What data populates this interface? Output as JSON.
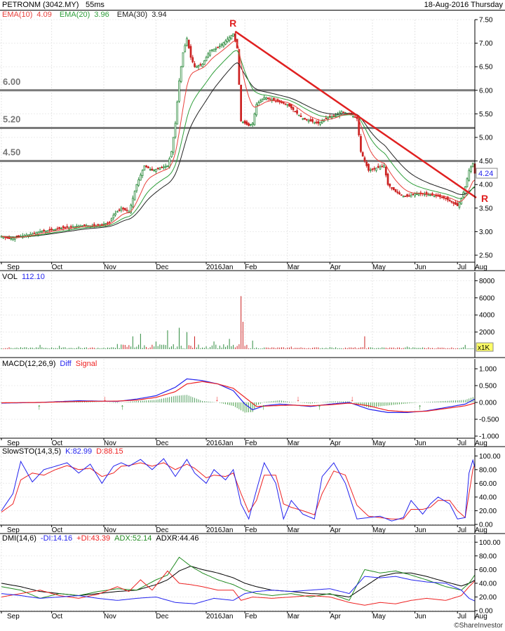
{
  "header": {
    "symbol": "PETRONM (3042.MY)",
    "timeframe": "55ms",
    "date": "18-Aug-2016 Thursday"
  },
  "brand": "©ShareInvestor",
  "colors": {
    "ema10": "#e8413c",
    "ema20": "#2e9e3a",
    "ema30": "#222222",
    "up": "#2e8b3e",
    "down": "#cc2222",
    "trend": "#e02020",
    "hline": "#7a7a7a",
    "blue": "#2222ee",
    "red": "#ee2222",
    "green": "#228b22",
    "black": "#000000"
  },
  "x_labels": [
    "Sep",
    "Oct",
    "Nov",
    "Dec",
    "2016Jan",
    "Feb",
    "Mar",
    "Apr",
    "May",
    "Jun",
    "Jul",
    "Aug"
  ],
  "panels": {
    "price": {
      "legend": [
        {
          "name": "EMA(10)",
          "value": "4.09",
          "color": "#e8413c"
        },
        {
          "name": "EMA(20)",
          "value": "3.96",
          "color": "#2e9e3a"
        },
        {
          "name": "EMA(30)",
          "value": "3.94",
          "color": "#222222"
        }
      ],
      "y_ticks": [
        "2.50",
        "3.00",
        "3.50",
        "4.00",
        "4.50",
        "5.00",
        "5.50",
        "6.00",
        "6.50",
        "7.00",
        "7.50"
      ],
      "h_levels": [
        {
          "value": 6.0,
          "label": "6.00"
        },
        {
          "value": 5.2,
          "label": "5.20"
        },
        {
          "value": 4.5,
          "label": "4.50"
        }
      ],
      "last_price": "4.24",
      "peak_marks": [
        "R",
        "R"
      ]
    },
    "vol": {
      "legend": [
        {
          "name": "VOL",
          "value": "112.10"
        }
      ],
      "y_ticks": [
        "2000",
        "4000",
        "6000",
        "8000"
      ],
      "unit": "x1K"
    },
    "macd": {
      "legend": [
        {
          "name": "MACD(12,26,9)"
        },
        {
          "name": "Diff"
        },
        {
          "name": "Signal"
        }
      ],
      "y_ticks": [
        "1.000",
        "0.500",
        "0.000",
        "-0.500",
        "-1.000"
      ]
    },
    "sto": {
      "legend": [
        {
          "name": "SlowSTO(14,3,5)"
        },
        {
          "name": "K:82.99"
        },
        {
          "name": "D:88.15"
        }
      ],
      "y_ticks": [
        "0.00",
        "20.00",
        "40.00",
        "60.00",
        "80.00",
        "100.00"
      ]
    },
    "dmi": {
      "legend": [
        {
          "name": "DMI(14,6)"
        },
        {
          "name": "-DI:14.16"
        },
        {
          "name": "+DI:43.39"
        },
        {
          "name": "ADX:52.14"
        },
        {
          "name": "ADXR:44.46"
        }
      ],
      "y_ticks": [
        "0.00",
        "20.00",
        "40.00",
        "60.00",
        "80.00",
        "100.00"
      ]
    }
  },
  "chart_data": {
    "type": "line",
    "title": "PETRONM (3042.MY)",
    "x": [
      "Sep",
      "Oct",
      "Nov",
      "Dec",
      "2016Jan",
      "Feb",
      "Mar",
      "Apr",
      "May",
      "Jun",
      "Jul",
      "Aug"
    ],
    "price_keypoints": [
      [
        0,
        2.9
      ],
      [
        4,
        2.85
      ],
      [
        8,
        2.88
      ],
      [
        12,
        2.92
      ],
      [
        16,
        2.95
      ],
      [
        20,
        3.0
      ],
      [
        24,
        3.02
      ],
      [
        28,
        3.05
      ],
      [
        32,
        3.08
      ],
      [
        36,
        3.1
      ],
      [
        40,
        3.12
      ],
      [
        44,
        3.13
      ],
      [
        48,
        3.12
      ],
      [
        52,
        3.15
      ],
      [
        56,
        3.2
      ],
      [
        58,
        3.35
      ],
      [
        62,
        3.5
      ],
      [
        66,
        3.42
      ],
      [
        70,
        4.0
      ],
      [
        74,
        4.4
      ],
      [
        78,
        4.3
      ],
      [
        82,
        4.35
      ],
      [
        86,
        4.4
      ],
      [
        88,
        4.7
      ],
      [
        90,
        5.3
      ],
      [
        92,
        6.2
      ],
      [
        94,
        6.8
      ],
      [
        96,
        7.1
      ],
      [
        98,
        6.7
      ],
      [
        100,
        6.5
      ],
      [
        104,
        6.55
      ],
      [
        108,
        6.85
      ],
      [
        112,
        6.9
      ],
      [
        116,
        7.05
      ],
      [
        120,
        7.2
      ],
      [
        122,
        6.9
      ],
      [
        124,
        5.35
      ],
      [
        126,
        5.3
      ],
      [
        128,
        5.25
      ],
      [
        130,
        5.3
      ],
      [
        132,
        5.7
      ],
      [
        136,
        5.85
      ],
      [
        140,
        5.8
      ],
      [
        144,
        5.75
      ],
      [
        148,
        5.7
      ],
      [
        152,
        5.55
      ],
      [
        156,
        5.4
      ],
      [
        160,
        5.35
      ],
      [
        164,
        5.3
      ],
      [
        168,
        5.4
      ],
      [
        172,
        5.45
      ],
      [
        176,
        5.55
      ],
      [
        180,
        5.5
      ],
      [
        184,
        5.4
      ],
      [
        186,
        4.7
      ],
      [
        190,
        4.3
      ],
      [
        194,
        4.35
      ],
      [
        198,
        4.4
      ],
      [
        200,
        4.0
      ],
      [
        204,
        3.85
      ],
      [
        208,
        3.75
      ],
      [
        210,
        3.75
      ],
      [
        214,
        3.8
      ],
      [
        218,
        3.8
      ],
      [
        222,
        3.78
      ],
      [
        226,
        3.75
      ],
      [
        230,
        3.7
      ],
      [
        234,
        3.6
      ],
      [
        236,
        3.55
      ],
      [
        238,
        3.7
      ],
      [
        240,
        3.95
      ],
      [
        242,
        4.3
      ],
      [
        244,
        4.45
      ],
      [
        245,
        4.24
      ]
    ],
    "ema10_last": 4.09,
    "ema20_last": 3.96,
    "ema30_last": 3.94,
    "volume_spikes": [
      [
        20,
        500
      ],
      [
        30,
        400
      ],
      [
        40,
        300
      ],
      [
        60,
        600
      ],
      [
        68,
        1500
      ],
      [
        72,
        1800
      ],
      [
        80,
        900
      ],
      [
        86,
        2200
      ],
      [
        92,
        2500
      ],
      [
        96,
        2000
      ],
      [
        100,
        1500
      ],
      [
        110,
        900
      ],
      [
        118,
        1200
      ],
      [
        124,
        6200
      ],
      [
        125,
        3200
      ],
      [
        130,
        1000
      ],
      [
        150,
        300
      ],
      [
        170,
        250
      ],
      [
        188,
        1500
      ],
      [
        210,
        300
      ],
      [
        240,
        500
      ],
      [
        245,
        112.1
      ]
    ],
    "macd_diff_keypoints": [
      [
        0,
        -0.02
      ],
      [
        20,
        0.0
      ],
      [
        40,
        0.05
      ],
      [
        60,
        0.03
      ],
      [
        70,
        0.1
      ],
      [
        80,
        0.2
      ],
      [
        90,
        0.45
      ],
      [
        96,
        0.7
      ],
      [
        104,
        0.65
      ],
      [
        112,
        0.55
      ],
      [
        120,
        0.35
      ],
      [
        126,
        -0.05
      ],
      [
        130,
        -0.22
      ],
      [
        136,
        -0.1
      ],
      [
        144,
        -0.05
      ],
      [
        152,
        -0.08
      ],
      [
        160,
        -0.12
      ],
      [
        170,
        -0.05
      ],
      [
        180,
        0.0
      ],
      [
        190,
        -0.2
      ],
      [
        200,
        -0.3
      ],
      [
        210,
        -0.3
      ],
      [
        220,
        -0.25
      ],
      [
        230,
        -0.15
      ],
      [
        240,
        -0.05
      ],
      [
        245,
        0.1
      ]
    ],
    "macd_signal_keypoints": [
      [
        0,
        -0.01
      ],
      [
        20,
        0.0
      ],
      [
        40,
        0.03
      ],
      [
        60,
        0.04
      ],
      [
        70,
        0.07
      ],
      [
        80,
        0.15
      ],
      [
        90,
        0.32
      ],
      [
        96,
        0.55
      ],
      [
        104,
        0.62
      ],
      [
        112,
        0.55
      ],
      [
        120,
        0.42
      ],
      [
        126,
        0.15
      ],
      [
        132,
        -0.12
      ],
      [
        140,
        -0.1
      ],
      [
        150,
        -0.08
      ],
      [
        160,
        -0.1
      ],
      [
        170,
        -0.07
      ],
      [
        180,
        -0.02
      ],
      [
        190,
        -0.1
      ],
      [
        200,
        -0.24
      ],
      [
        210,
        -0.28
      ],
      [
        220,
        -0.26
      ],
      [
        230,
        -0.18
      ],
      [
        240,
        -0.1
      ],
      [
        245,
        -0.02
      ]
    ],
    "sto_k_keypoints": [
      [
        0,
        20
      ],
      [
        6,
        45
      ],
      [
        10,
        92
      ],
      [
        16,
        62
      ],
      [
        22,
        80
      ],
      [
        28,
        85
      ],
      [
        34,
        90
      ],
      [
        40,
        75
      ],
      [
        46,
        88
      ],
      [
        52,
        60
      ],
      [
        58,
        85
      ],
      [
        62,
        90
      ],
      [
        66,
        85
      ],
      [
        72,
        95
      ],
      [
        78,
        80
      ],
      [
        84,
        96
      ],
      [
        90,
        70
      ],
      [
        96,
        95
      ],
      [
        100,
        75
      ],
      [
        106,
        60
      ],
      [
        110,
        80
      ],
      [
        116,
        65
      ],
      [
        120,
        80
      ],
      [
        124,
        30
      ],
      [
        128,
        8
      ],
      [
        132,
        50
      ],
      [
        136,
        90
      ],
      [
        142,
        60
      ],
      [
        146,
        8
      ],
      [
        150,
        35
      ],
      [
        156,
        15
      ],
      [
        162,
        8
      ],
      [
        166,
        70
      ],
      [
        172,
        90
      ],
      [
        178,
        60
      ],
      [
        184,
        8
      ],
      [
        190,
        10
      ],
      [
        196,
        12
      ],
      [
        202,
        5
      ],
      [
        208,
        10
      ],
      [
        212,
        35
      ],
      [
        218,
        15
      ],
      [
        222,
        30
      ],
      [
        226,
        40
      ],
      [
        232,
        30
      ],
      [
        236,
        8
      ],
      [
        240,
        10
      ],
      [
        242,
        75
      ],
      [
        244,
        94
      ],
      [
        245,
        82.99
      ]
    ],
    "sto_d_keypoints": [
      [
        0,
        18
      ],
      [
        6,
        30
      ],
      [
        10,
        65
      ],
      [
        16,
        75
      ],
      [
        22,
        72
      ],
      [
        28,
        80
      ],
      [
        34,
        86
      ],
      [
        40,
        80
      ],
      [
        46,
        82
      ],
      [
        52,
        70
      ],
      [
        58,
        75
      ],
      [
        62,
        85
      ],
      [
        66,
        86
      ],
      [
        72,
        90
      ],
      [
        78,
        85
      ],
      [
        84,
        90
      ],
      [
        90,
        80
      ],
      [
        96,
        88
      ],
      [
        100,
        82
      ],
      [
        106,
        68
      ],
      [
        110,
        72
      ],
      [
        116,
        70
      ],
      [
        120,
        75
      ],
      [
        124,
        45
      ],
      [
        128,
        18
      ],
      [
        132,
        35
      ],
      [
        136,
        72
      ],
      [
        142,
        72
      ],
      [
        146,
        30
      ],
      [
        150,
        25
      ],
      [
        156,
        20
      ],
      [
        162,
        14
      ],
      [
        166,
        45
      ],
      [
        172,
        78
      ],
      [
        178,
        72
      ],
      [
        184,
        28
      ],
      [
        190,
        12
      ],
      [
        196,
        10
      ],
      [
        202,
        8
      ],
      [
        208,
        8
      ],
      [
        212,
        22
      ],
      [
        218,
        22
      ],
      [
        222,
        25
      ],
      [
        226,
        35
      ],
      [
        232,
        35
      ],
      [
        236,
        20
      ],
      [
        240,
        10
      ],
      [
        242,
        45
      ],
      [
        244,
        80
      ],
      [
        245,
        88.15
      ]
    ],
    "dmi_minus_keypoints": [
      [
        0,
        25
      ],
      [
        10,
        22
      ],
      [
        20,
        18
      ],
      [
        30,
        20
      ],
      [
        40,
        22
      ],
      [
        50,
        18
      ],
      [
        60,
        15
      ],
      [
        70,
        18
      ],
      [
        80,
        20
      ],
      [
        90,
        12
      ],
      [
        100,
        10
      ],
      [
        110,
        18
      ],
      [
        120,
        15
      ],
      [
        126,
        25
      ],
      [
        132,
        28
      ],
      [
        140,
        30
      ],
      [
        150,
        28
      ],
      [
        160,
        30
      ],
      [
        170,
        32
      ],
      [
        180,
        25
      ],
      [
        188,
        50
      ],
      [
        196,
        48
      ],
      [
        204,
        50
      ],
      [
        212,
        45
      ],
      [
        220,
        42
      ],
      [
        230,
        40
      ],
      [
        238,
        30
      ],
      [
        242,
        18
      ],
      [
        245,
        14.16
      ]
    ],
    "dmi_plus_keypoints": [
      [
        0,
        20
      ],
      [
        10,
        25
      ],
      [
        20,
        30
      ],
      [
        30,
        22
      ],
      [
        40,
        18
      ],
      [
        50,
        24
      ],
      [
        60,
        35
      ],
      [
        66,
        28
      ],
      [
        72,
        45
      ],
      [
        78,
        30
      ],
      [
        86,
        58
      ],
      [
        92,
        40
      ],
      [
        98,
        38
      ],
      [
        104,
        35
      ],
      [
        112,
        30
      ],
      [
        120,
        30
      ],
      [
        124,
        15
      ],
      [
        130,
        20
      ],
      [
        140,
        18
      ],
      [
        150,
        20
      ],
      [
        160,
        22
      ],
      [
        170,
        20
      ],
      [
        180,
        12
      ],
      [
        188,
        8
      ],
      [
        196,
        12
      ],
      [
        204,
        10
      ],
      [
        212,
        15
      ],
      [
        220,
        18
      ],
      [
        230,
        15
      ],
      [
        238,
        22
      ],
      [
        242,
        35
      ],
      [
        245,
        43.39
      ]
    ],
    "dmi_adx_keypoints": [
      [
        0,
        35
      ],
      [
        10,
        30
      ],
      [
        20,
        18
      ],
      [
        30,
        25
      ],
      [
        40,
        22
      ],
      [
        50,
        28
      ],
      [
        60,
        32
      ],
      [
        70,
        30
      ],
      [
        80,
        45
      ],
      [
        86,
        52
      ],
      [
        92,
        78
      ],
      [
        98,
        65
      ],
      [
        104,
        55
      ],
      [
        112,
        45
      ],
      [
        120,
        38
      ],
      [
        126,
        30
      ],
      [
        132,
        25
      ],
      [
        140,
        22
      ],
      [
        150,
        25
      ],
      [
        160,
        20
      ],
      [
        170,
        25
      ],
      [
        180,
        15
      ],
      [
        188,
        60
      ],
      [
        196,
        55
      ],
      [
        204,
        58
      ],
      [
        212,
        52
      ],
      [
        220,
        45
      ],
      [
        230,
        35
      ],
      [
        238,
        30
      ],
      [
        242,
        40
      ],
      [
        245,
        52.14
      ]
    ],
    "dmi_adxr_keypoints": [
      [
        0,
        40
      ],
      [
        10,
        35
      ],
      [
        20,
        28
      ],
      [
        30,
        25
      ],
      [
        40,
        22
      ],
      [
        50,
        25
      ],
      [
        60,
        28
      ],
      [
        70,
        30
      ],
      [
        80,
        38
      ],
      [
        86,
        45
      ],
      [
        92,
        58
      ],
      [
        98,
        65
      ],
      [
        104,
        60
      ],
      [
        112,
        55
      ],
      [
        120,
        48
      ],
      [
        126,
        40
      ],
      [
        132,
        35
      ],
      [
        140,
        30
      ],
      [
        150,
        28
      ],
      [
        160,
        25
      ],
      [
        170,
        24
      ],
      [
        180,
        20
      ],
      [
        188,
        35
      ],
      [
        196,
        50
      ],
      [
        204,
        55
      ],
      [
        212,
        55
      ],
      [
        220,
        50
      ],
      [
        230,
        42
      ],
      [
        238,
        36
      ],
      [
        242,
        40
      ],
      [
        245,
        44.46
      ]
    ]
  }
}
